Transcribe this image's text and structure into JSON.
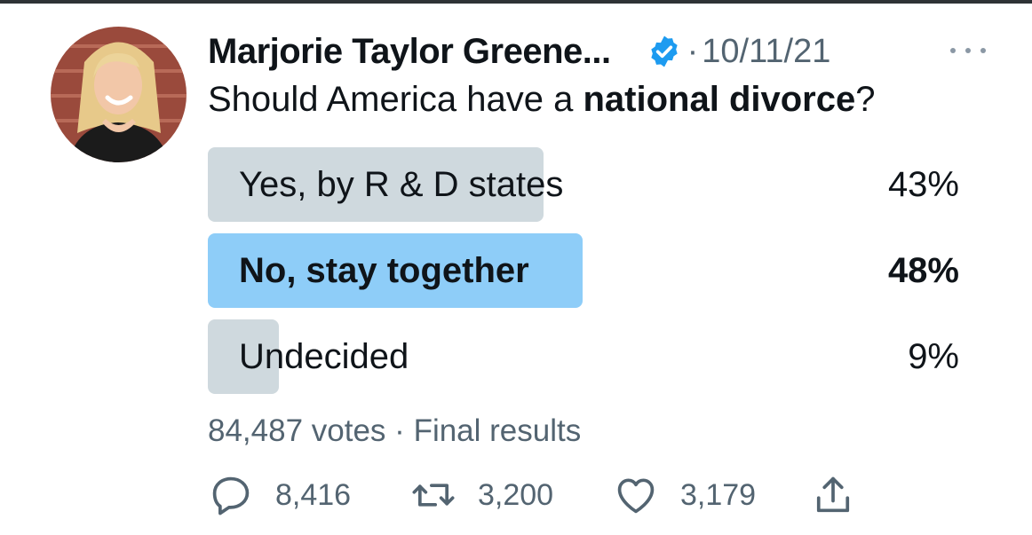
{
  "tweet": {
    "author_name": "Marjorie Taylor Greene...",
    "separator": "·",
    "date": "10/11/21",
    "question_prefix": "Should America have a ",
    "question_bold": "national divorce",
    "question_suffix": "?"
  },
  "poll": {
    "options": [
      {
        "label": "Yes, by R & D states",
        "percent_text": "43%",
        "percent": 43,
        "winner": false
      },
      {
        "label": "No, stay together",
        "percent_text": "48%",
        "percent": 48,
        "winner": true
      },
      {
        "label": "Undecided",
        "percent_text": "9%",
        "percent": 9,
        "winner": false
      }
    ],
    "votes": "84,487 votes",
    "summary_separator": "·",
    "status": "Final results"
  },
  "actions": {
    "replies": "8,416",
    "retweets": "3,200",
    "likes": "3,179"
  },
  "icons": {
    "verified": "verified-badge-icon",
    "more": "more-icon",
    "reply": "reply-icon",
    "retweet": "retweet-icon",
    "like": "heart-icon",
    "share": "share-icon"
  },
  "colors": {
    "verified": "#1d9bf0",
    "winner_fill": "#8ecdf8",
    "loser_fill": "#cfd9de",
    "secondary_text": "#536471"
  }
}
